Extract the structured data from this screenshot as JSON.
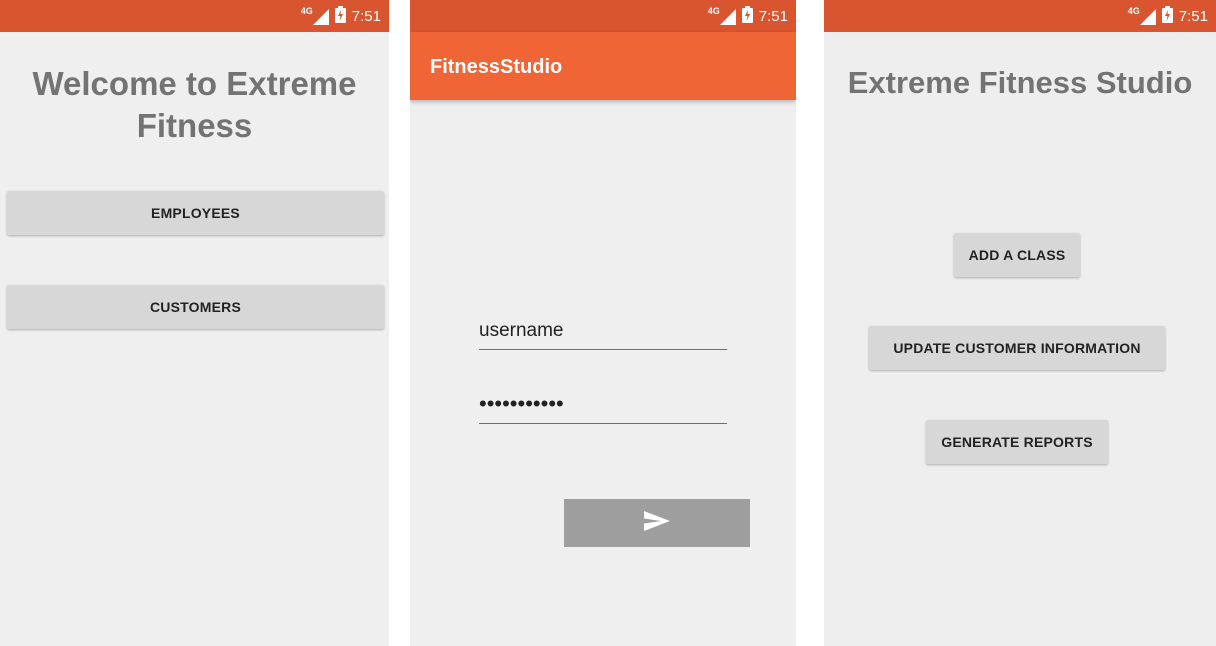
{
  "status_bar": {
    "network": "4G",
    "time": "7:51",
    "color": "#d85530"
  },
  "screen_welcome": {
    "title": "Welcome to Extreme Fitness",
    "buttons": {
      "employees": "EMPLOYEES",
      "customers": "CUSTOMERS"
    }
  },
  "screen_login": {
    "action_bar_title": "FitnessStudio",
    "action_bar_color": "#ef6536",
    "username_value": "username",
    "password_value": "•••••••••••",
    "submit_icon": "send-arrow-icon"
  },
  "screen_employee_menu": {
    "title": "Extreme Fitness Studio",
    "buttons": {
      "add_class": "ADD A CLASS",
      "update_customer": "UPDATE CUSTOMER INFORMATION",
      "generate_reports": "GENERATE REPORTS"
    }
  }
}
